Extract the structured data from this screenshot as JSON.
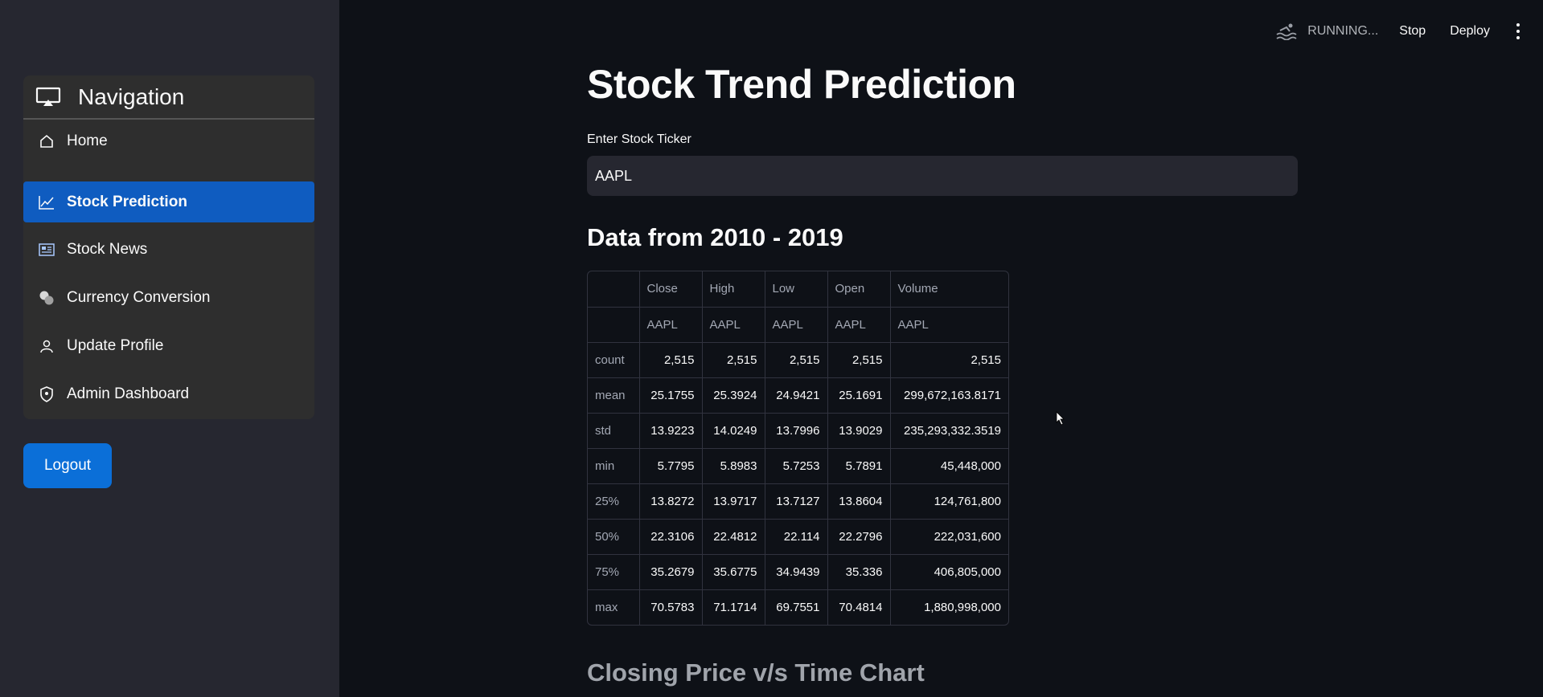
{
  "sidebar": {
    "title": "Navigation",
    "items": [
      {
        "label": "Home",
        "icon": "home-icon"
      },
      {
        "label": "Stock Prediction",
        "icon": "chart-line-icon",
        "active": true
      },
      {
        "label": "Stock News",
        "icon": "newspaper-icon"
      },
      {
        "label": "Currency Conversion",
        "icon": "coins-icon"
      },
      {
        "label": "Update Profile",
        "icon": "person-icon"
      },
      {
        "label": "Admin Dashboard",
        "icon": "shield-icon"
      }
    ],
    "logout_label": "Logout"
  },
  "topbar": {
    "status": "RUNNING...",
    "stop_label": "Stop",
    "deploy_label": "Deploy"
  },
  "main": {
    "title": "Stock Trend Prediction",
    "input_label": "Enter Stock Ticker",
    "ticker_value": "AAPL",
    "section_data": "Data from 2010 - 2019",
    "section_chart": "Closing Price v/s Time Chart"
  },
  "table": {
    "columns": [
      "Close",
      "High",
      "Low",
      "Open",
      "Volume"
    ],
    "tickers": [
      "AAPL",
      "AAPL",
      "AAPL",
      "AAPL",
      "AAPL"
    ],
    "rows": [
      {
        "label": "count",
        "values": [
          "2,515",
          "2,515",
          "2,515",
          "2,515",
          "2,515"
        ]
      },
      {
        "label": "mean",
        "values": [
          "25.1755",
          "25.3924",
          "24.9421",
          "25.1691",
          "299,672,163.8171"
        ]
      },
      {
        "label": "std",
        "values": [
          "13.9223",
          "14.0249",
          "13.7996",
          "13.9029",
          "235,293,332.3519"
        ]
      },
      {
        "label": "min",
        "values": [
          "5.7795",
          "5.8983",
          "5.7253",
          "5.7891",
          "45,448,000"
        ]
      },
      {
        "label": "25%",
        "values": [
          "13.8272",
          "13.9717",
          "13.7127",
          "13.8604",
          "124,761,800"
        ]
      },
      {
        "label": "50%",
        "values": [
          "22.3106",
          "22.4812",
          "22.114",
          "22.2796",
          "222,031,600"
        ]
      },
      {
        "label": "75%",
        "values": [
          "35.2679",
          "35.6775",
          "34.9439",
          "35.336",
          "406,805,000"
        ]
      },
      {
        "label": "max",
        "values": [
          "70.5783",
          "71.1714",
          "69.7551",
          "70.4814",
          "1,880,998,000"
        ]
      }
    ]
  },
  "colors": {
    "accent": "#0f5cc0",
    "background": "#0e1117",
    "sidebar": "#262730"
  }
}
